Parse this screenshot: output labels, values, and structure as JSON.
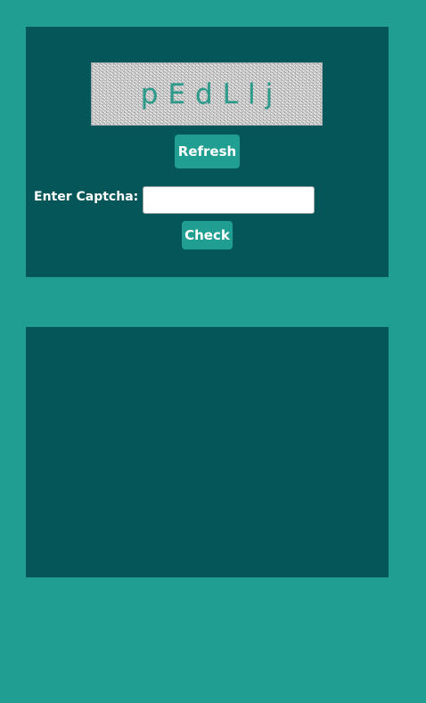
{
  "captcha": {
    "code": "pEdLlj",
    "refresh_label": "Refresh",
    "input_label": "Enter Captcha:",
    "input_value": "",
    "check_label": "Check"
  },
  "colors": {
    "page_background": "#1f9e91",
    "panel_background": "#055659",
    "button_background": "#1f9e91",
    "captcha_text": "#2e9a8b"
  }
}
